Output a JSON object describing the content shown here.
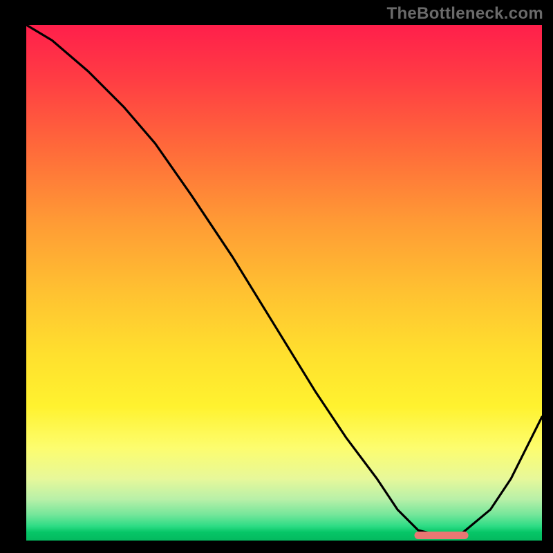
{
  "watermark": "TheBottleneck.com",
  "chart_data": {
    "type": "line",
    "title": "",
    "xlabel": "",
    "ylabel": "",
    "xlim": [
      0,
      100
    ],
    "ylim": [
      0,
      100
    ],
    "grid": false,
    "legend": false,
    "x": [
      0,
      5,
      12,
      19,
      25,
      32,
      40,
      48,
      56,
      62,
      68,
      72,
      76,
      80,
      84,
      90,
      94,
      98,
      100
    ],
    "values": [
      100,
      97,
      91,
      84,
      77,
      67,
      55,
      42,
      29,
      20,
      12,
      6,
      2,
      1,
      1,
      6,
      12,
      20,
      24
    ],
    "marker_segment": {
      "x_start": 76,
      "x_end": 85,
      "y": 1
    }
  },
  "colors": {
    "curve": "#000000",
    "marker": "#e87773",
    "gradient_top": "#ff1f4b",
    "gradient_bottom": "#04b95f",
    "background": "#000000",
    "watermark": "#6a6a6a"
  }
}
